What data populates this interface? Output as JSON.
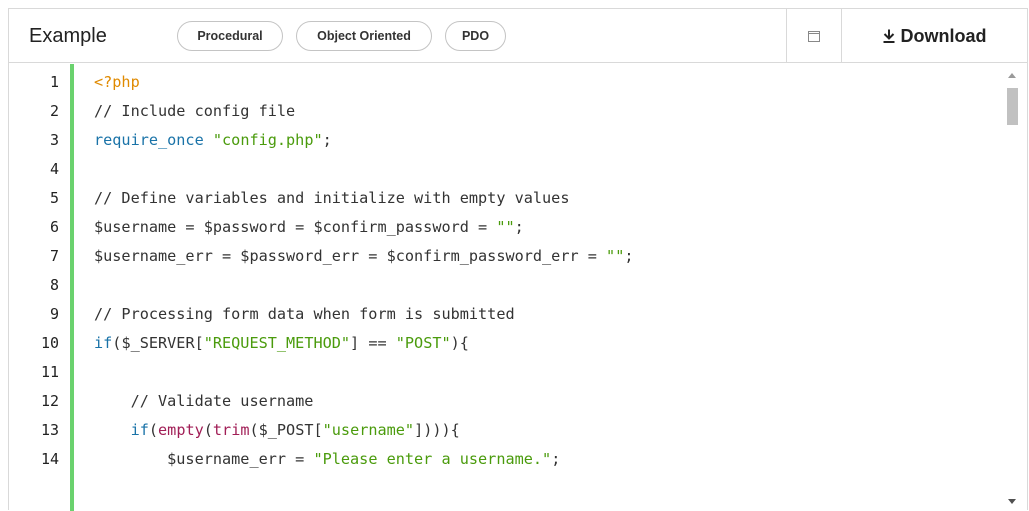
{
  "header": {
    "title": "Example",
    "tabs": [
      {
        "label": "Procedural"
      },
      {
        "label": "Object Oriented"
      },
      {
        "label": "PDO"
      }
    ],
    "window_icon": "window-restore-icon",
    "download_label": "Download",
    "download_icon": "download-icon"
  },
  "editor": {
    "accent_color": "#6ad26e",
    "line_numbers": [
      "1",
      "2",
      "3",
      "4",
      "5",
      "6",
      "7",
      "8",
      "9",
      "10",
      "11",
      "12",
      "13",
      "14"
    ],
    "lines": [
      "<?php",
      "// Include config file",
      "require_once \"config.php\";",
      "",
      "// Define variables and initialize with empty values",
      "$username = $password = $confirm_password = \"\";",
      "$username_err = $password_err = $confirm_password_err = \"\";",
      "",
      "// Processing form data when form is submitted",
      "if($_SERVER[\"REQUEST_METHOD\"] == \"POST\"){",
      "",
      "    // Validate username",
      "    if(empty(trim($_POST[\"username\"]))){",
      "        $username_err = \"Please enter a username.\";"
    ]
  },
  "scrollbar": {
    "up_icon": "scroll-up-arrow-icon",
    "down_icon": "scroll-down-arrow-icon",
    "position": 0.0
  }
}
